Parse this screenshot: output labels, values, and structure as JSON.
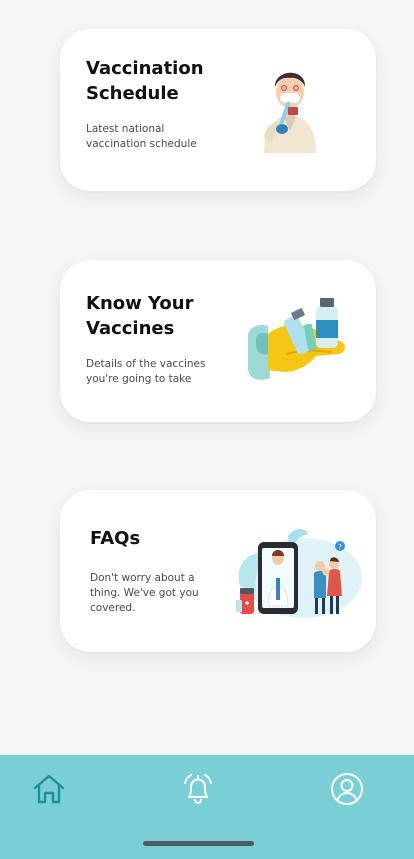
{
  "cards": [
    {
      "title": "Vaccination Schedule",
      "title_line1": "Vaccination",
      "title_line2": "Schedule",
      "desc_line1": "Latest national",
      "desc_line2": "vaccination schedule",
      "icon": "doctor-with-syringe-illustration"
    },
    {
      "title": "Know Your Vaccines",
      "title_line1": "Know Your",
      "title_line2": "Vaccines",
      "desc_line1": "Details of the vaccines",
      "desc_line2": "you're going to take",
      "icon": "hand-holding-vaccine-vials-illustration"
    },
    {
      "title": "FAQs",
      "title_line1": "FAQs",
      "desc_line1": "Don't worry about a",
      "desc_line2": "thing. We've got you",
      "desc_line3": "covered.",
      "icon": "doctor-on-phone-family-illustration"
    }
  ],
  "bottom_nav": {
    "items": [
      {
        "name": "home",
        "icon": "home-icon",
        "active": true
      },
      {
        "name": "notifications",
        "icon": "bell-icon",
        "active": false
      },
      {
        "name": "profile",
        "icon": "user-icon",
        "active": false
      }
    ],
    "active_color": "#1c8f98",
    "inactive_color": "#ffffff",
    "bar_color": "#7acfd6"
  }
}
